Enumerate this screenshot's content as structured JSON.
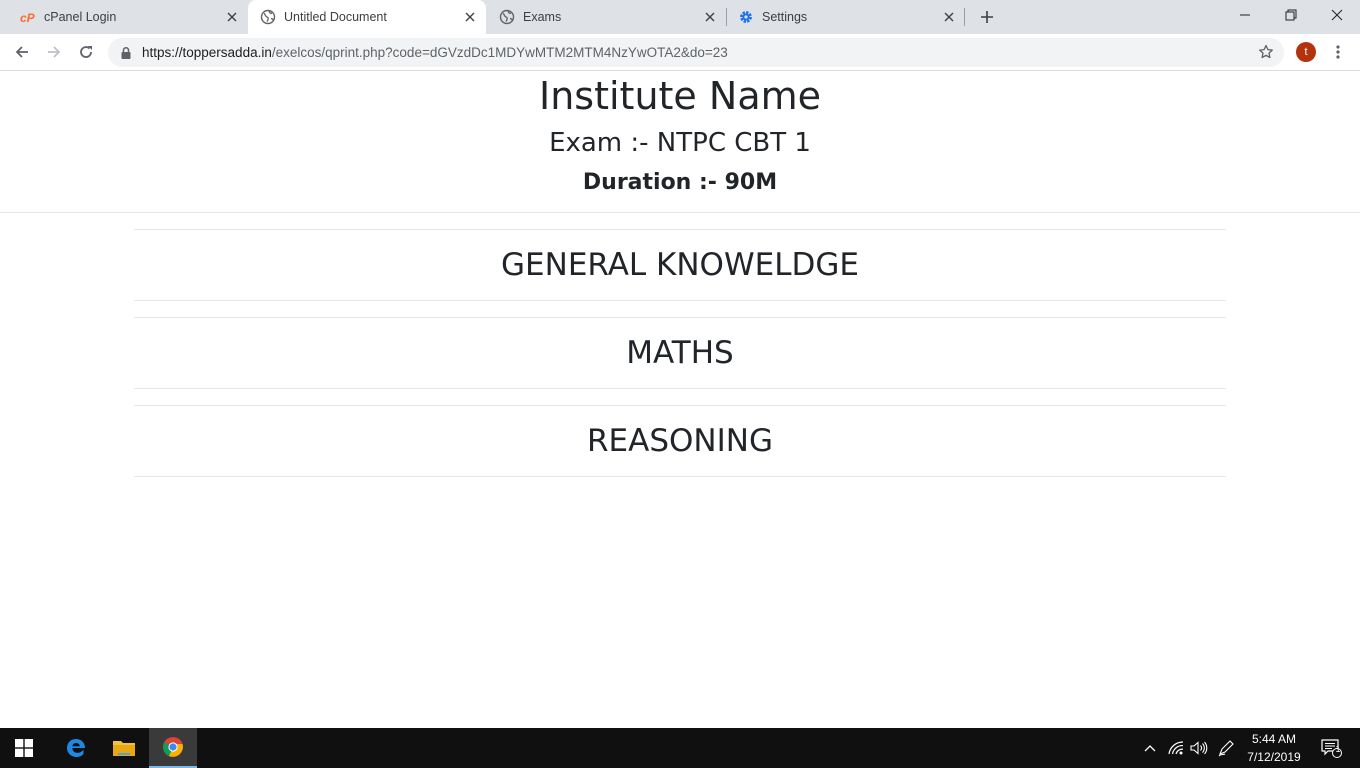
{
  "browser": {
    "tabs": [
      {
        "title": "cPanel Login",
        "icon": "cpanel-icon"
      },
      {
        "title": "Untitled Document",
        "icon": "globe-icon",
        "active": true
      },
      {
        "title": "Exams",
        "icon": "globe-icon"
      },
      {
        "title": "Settings",
        "icon": "gear-icon"
      }
    ],
    "url_host": "https://toppersadda.in",
    "url_path": "/exelcos/qprint.php?code=dGVzdDc1MDYwMTM2MTM4NzYwOTA2&do=23",
    "profile_initial": "t",
    "colors": {
      "profile": "#b5320e",
      "tabstrip": "#dee1e6"
    }
  },
  "page": {
    "institute_name": "Institute Name",
    "exam": "Exam :- NTPC CBT 1",
    "duration": "Duration :- 90M",
    "sections": [
      "GENERAL KNOWELDGE",
      "MATHS",
      "REASONING"
    ]
  },
  "taskbar": {
    "time": "5:44 AM",
    "date": "7/12/2019",
    "notification_count": "1"
  }
}
